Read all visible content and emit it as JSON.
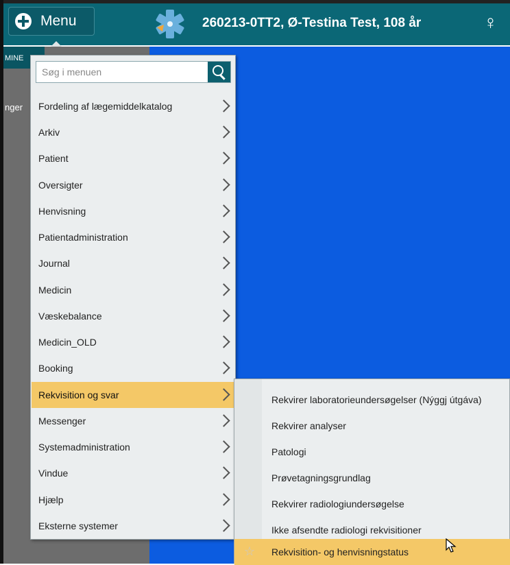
{
  "header": {
    "menu_label": "Menu",
    "patient": "260213-0TT2,  Ø-Testina Test,  108 år",
    "gender_symbol": "♀"
  },
  "background": {
    "left_label_top": "MINE",
    "left_label_side": "nger"
  },
  "search": {
    "placeholder": "Søg i menuen"
  },
  "menu": {
    "items": [
      {
        "label": "Fordeling af lægemiddelkatalog"
      },
      {
        "label": "Arkiv"
      },
      {
        "label": "Patient"
      },
      {
        "label": "Oversigter"
      },
      {
        "label": "Henvisning"
      },
      {
        "label": "Patientadministration"
      },
      {
        "label": "Journal"
      },
      {
        "label": "Medicin"
      },
      {
        "label": "Væskebalance"
      },
      {
        "label": "Medicin_OLD"
      },
      {
        "label": "Booking"
      },
      {
        "label": "Rekvisition og svar"
      },
      {
        "label": "Messenger"
      },
      {
        "label": "Systemadministration"
      },
      {
        "label": "Vindue"
      },
      {
        "label": "Hjælp"
      },
      {
        "label": "Eksterne systemer"
      }
    ],
    "active_item": "Rekvisition og svar"
  },
  "submenu": {
    "items": [
      {
        "label": "Rekvirer laboratorieundersøgelser (Nýggj útgáva)"
      },
      {
        "label": "Rekvirer analyser"
      },
      {
        "label": "Patologi"
      },
      {
        "label": "Prøvetagningsgrundlag"
      },
      {
        "label": "Rekvirer radiologiundersøgelse"
      },
      {
        "label": "Ikke afsendte radiologi rekvisitioner"
      },
      {
        "label": "Rekvisition- og henvisningstatus"
      }
    ],
    "hovered_item": "Rekvisition- og henvisningstatus"
  },
  "colors": {
    "header": "#0b6776",
    "highlight": "#f4c867",
    "workspace": "#0c5ce0",
    "star_of_life": "#6ab0dd"
  },
  "icons": [
    "plus-circle-icon",
    "star-of-life-icon",
    "female-icon",
    "search-icon",
    "chevron-right-icon",
    "star-icon",
    "mouse-cursor-icon"
  ]
}
